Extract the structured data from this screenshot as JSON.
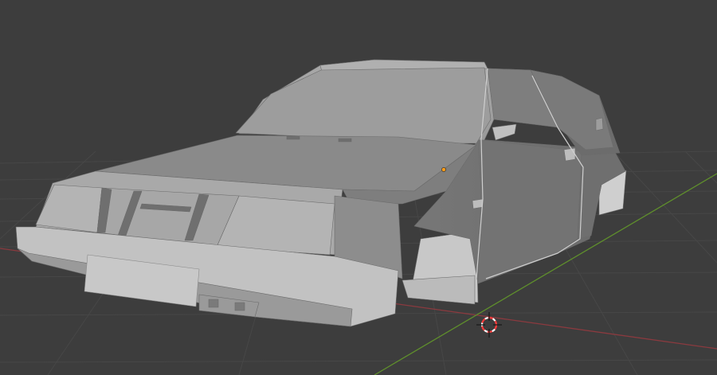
{
  "viewport": {
    "editor": "3D Viewport",
    "view_mode": "solid-shading",
    "colors": {
      "background": "#3d3d3d",
      "grid_line": "#4a4a4a",
      "x_axis": "#8a3a3f",
      "y_axis": "#5f8f2c",
      "mesh_base": "#8e8e8e",
      "selection_outline": "#cfcfcf",
      "origin_dot": "#ff9d1a",
      "cursor_red": "#ff3b3b",
      "cursor_white": "#ffffff"
    },
    "icons": {
      "cursor": "3d-cursor-icon",
      "origin": "object-origin-icon"
    }
  }
}
